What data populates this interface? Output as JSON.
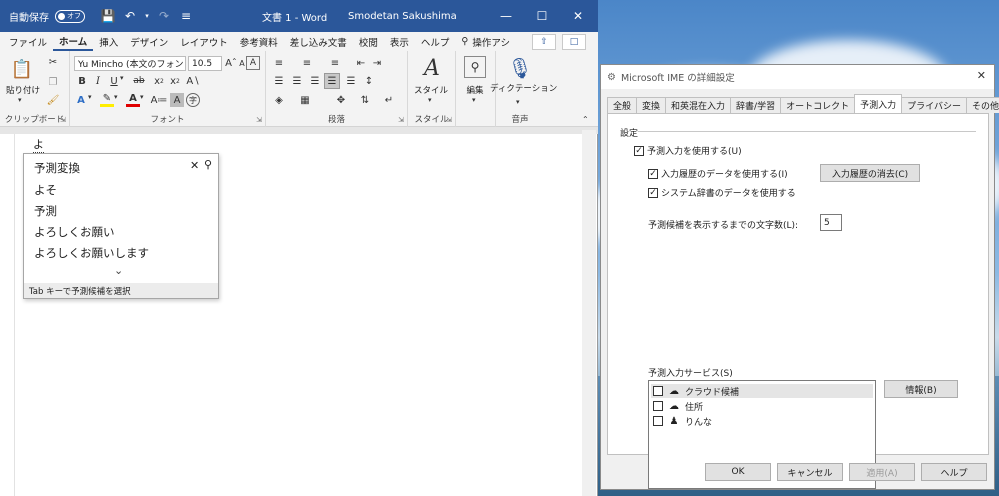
{
  "word": {
    "autosave_label": "自動保存",
    "autosave_state": "オフ",
    "doc_title": "文書 1  -  Word",
    "user_name": "Smodetan Sakushima",
    "tabs": [
      "ファイル",
      "ホーム",
      "挿入",
      "デザイン",
      "レイアウト",
      "参考資料",
      "差し込み文書",
      "校閲",
      "表示",
      "ヘルプ",
      "操作アシ"
    ],
    "active_tab": "ホーム",
    "ribbon": {
      "paste_label": "貼り付け",
      "clipboard_label": "クリップボード",
      "font_name": "Yu Mincho (本文のフォント)",
      "font_size": "10.5",
      "font_label": "フォント",
      "paragraph_label": "段落",
      "style_button_label": "スタイル",
      "style_label": "スタイル",
      "edit_label": "編集",
      "dictation_label": "ディクテーション",
      "voice_label": "音声"
    },
    "typed_text": "よ",
    "ime_candidates": {
      "header": "予測変換",
      "items": [
        "よそ",
        "予測",
        "よろしくお願い",
        "よろしくお願いします"
      ],
      "footer": "Tab キーで予測候補を選択"
    }
  },
  "ime_dialog": {
    "title": "Microsoft IME の詳細設定",
    "tabs": [
      "全般",
      "変換",
      "和英混在入力",
      "辞書/学習",
      "オートコレクト",
      "予測入力",
      "プライバシー",
      "その他"
    ],
    "active_tab": "予測入力",
    "section_title": "設定",
    "use_prediction": {
      "label": "予測入力を使用する(U)",
      "checked": true
    },
    "use_history": {
      "label": "入力履歴のデータを使用する(I)",
      "checked": true
    },
    "use_system_dict": {
      "label": "システム辞書のデータを使用する",
      "checked": true
    },
    "clear_history_button": "入力履歴の消去(C)",
    "char_count_label": "予測候補を表示するまでの文字数(L):",
    "char_count_value": "5",
    "services_label": "予測入力サービス(S)",
    "services": [
      {
        "name": "クラウド候補",
        "icon": "cloud-icon",
        "checked": false
      },
      {
        "name": "住所",
        "icon": "cloud-icon",
        "checked": false
      },
      {
        "name": "りんな",
        "icon": "rinna-avatar-icon",
        "checked": false
      }
    ],
    "info_button": "情報(B)",
    "ok_button": "OK",
    "cancel_button": "キャンセル",
    "apply_button": "適用(A)",
    "help_button": "ヘルプ"
  }
}
